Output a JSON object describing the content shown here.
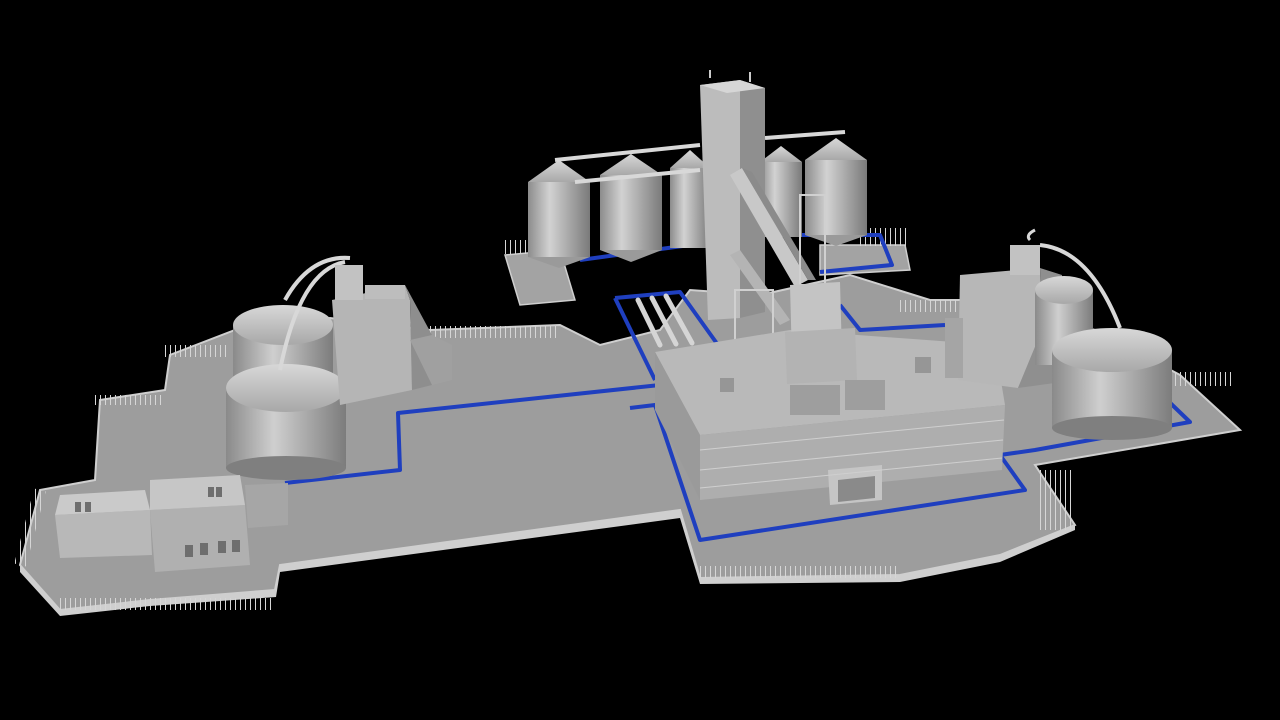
{
  "scene": {
    "subject": "",
    "colors": {
      "background": "#000000",
      "ground": "#9d9d9d",
      "ground_edge": "#cfcfcf",
      "building_light": "#bdbdbd",
      "building_mid": "#a6a6a6",
      "building_dark": "#7e7e7e",
      "silo_light": "#c9c9c9",
      "silo_dark": "#8c8c8c",
      "fence": "#d8d8d8",
      "pipe_line": "#1f3fbf"
    }
  }
}
